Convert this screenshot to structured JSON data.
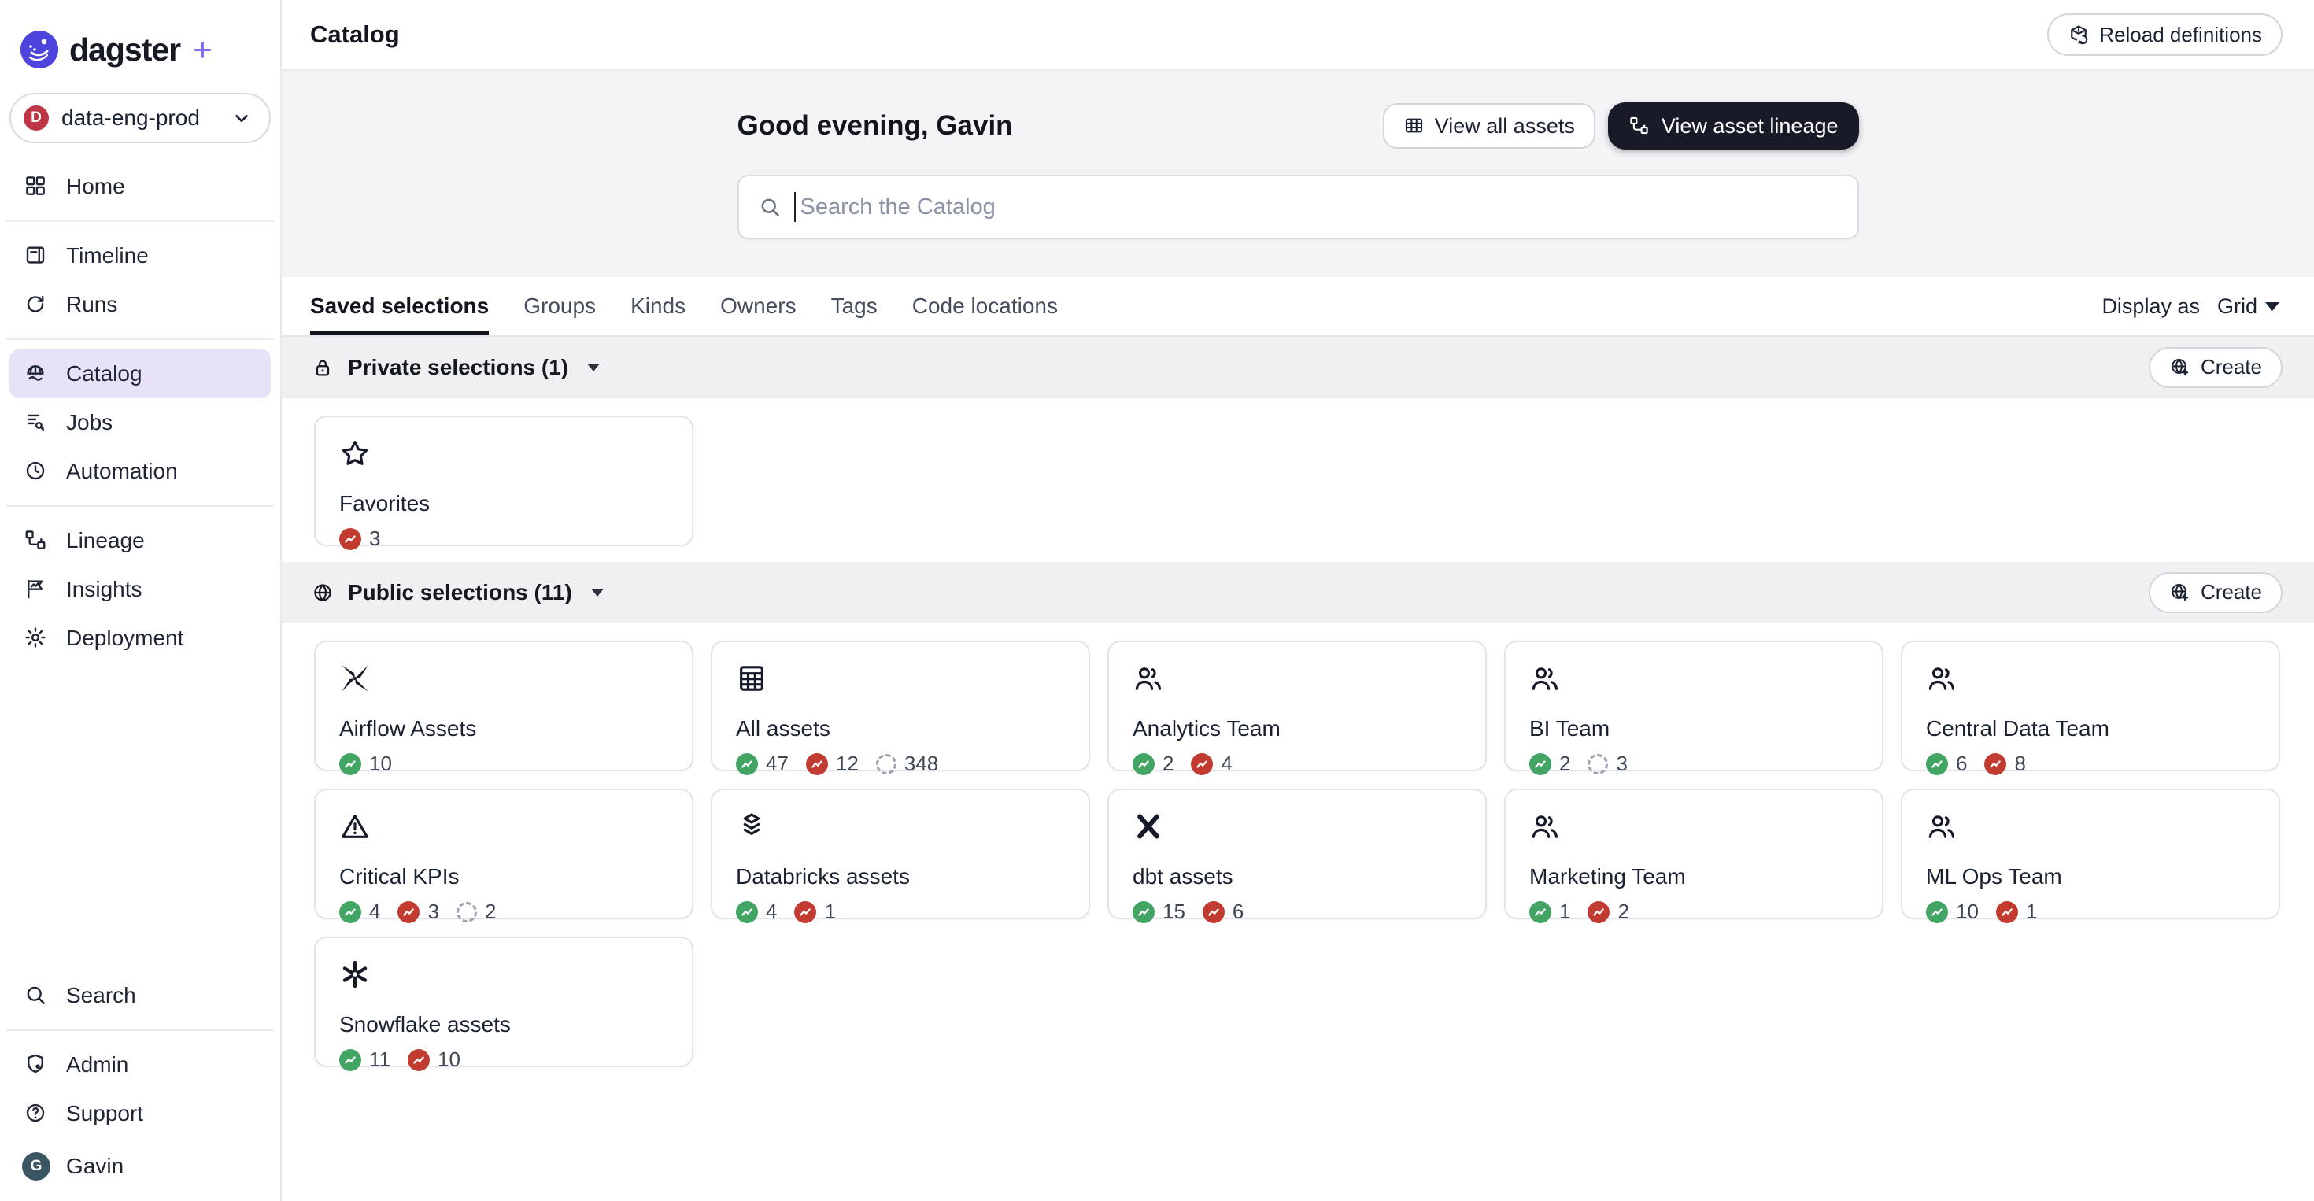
{
  "brand": {
    "name": "dagster",
    "plus": "+"
  },
  "workspace": {
    "label": "data-eng-prod",
    "avatar_letter": "D",
    "avatar_color": "#BE3645"
  },
  "sidebar": {
    "groups": [
      {
        "items": [
          {
            "label": "Home",
            "icon": "home-grid",
            "active": false
          }
        ]
      },
      {
        "items": [
          {
            "label": "Timeline",
            "icon": "timeline",
            "active": false
          },
          {
            "label": "Runs",
            "icon": "runs",
            "active": false
          }
        ]
      },
      {
        "items": [
          {
            "label": "Catalog",
            "icon": "catalog-globe",
            "active": true
          },
          {
            "label": "Jobs",
            "icon": "jobs",
            "active": false
          },
          {
            "label": "Automation",
            "icon": "clock",
            "active": false
          }
        ]
      },
      {
        "items": [
          {
            "label": "Lineage",
            "icon": "lineage",
            "active": false
          },
          {
            "label": "Insights",
            "icon": "insights-flag",
            "active": false
          },
          {
            "label": "Deployment",
            "icon": "gear",
            "active": false
          }
        ]
      }
    ],
    "bottom_groups": [
      {
        "items": [
          {
            "label": "Search",
            "icon": "search",
            "active": false
          }
        ]
      },
      {
        "items": [
          {
            "label": "Admin",
            "icon": "shield",
            "active": false
          },
          {
            "label": "Support",
            "icon": "help-circle",
            "active": false
          }
        ]
      }
    ],
    "user": {
      "name": "Gavin",
      "avatar_letter": "G",
      "avatar_color": "#3B5663"
    }
  },
  "header": {
    "title": "Catalog",
    "reload_button_label": "Reload definitions"
  },
  "hero": {
    "greeting": "Good evening, Gavin",
    "view_all_assets_label": "View all assets",
    "view_asset_lineage_label": "View asset lineage",
    "search_placeholder": "Search the Catalog"
  },
  "tabs": {
    "items": [
      "Saved selections",
      "Groups",
      "Kinds",
      "Owners",
      "Tags",
      "Code locations"
    ],
    "active": "Saved selections",
    "display_as_label": "Display as",
    "display_as_value": "Grid"
  },
  "sections": [
    {
      "title": "Private selections (1)",
      "icon": "lock",
      "create_label": "Create",
      "cards": [
        {
          "title": "Favorites",
          "icon": "star",
          "counts": [
            {
              "type": "failed",
              "value": "3"
            }
          ]
        }
      ]
    },
    {
      "title": "Public selections (11)",
      "icon": "globe",
      "create_label": "Create",
      "cards": [
        {
          "title": "Airflow Assets",
          "icon": "airflow",
          "counts": [
            {
              "type": "success",
              "value": "10"
            }
          ]
        },
        {
          "title": "All assets",
          "icon": "table",
          "counts": [
            {
              "type": "success",
              "value": "47"
            },
            {
              "type": "failed",
              "value": "12"
            },
            {
              "type": "never",
              "value": "348"
            }
          ]
        },
        {
          "title": "Analytics Team",
          "icon": "people",
          "counts": [
            {
              "type": "success",
              "value": "2"
            },
            {
              "type": "failed",
              "value": "4"
            }
          ]
        },
        {
          "title": "BI Team",
          "icon": "people",
          "counts": [
            {
              "type": "success",
              "value": "2"
            },
            {
              "type": "never",
              "value": "3"
            }
          ]
        },
        {
          "title": "Central Data Team",
          "icon": "people",
          "counts": [
            {
              "type": "success",
              "value": "6"
            },
            {
              "type": "failed",
              "value": "8"
            }
          ]
        },
        {
          "title": "Critical KPIs",
          "icon": "warning",
          "counts": [
            {
              "type": "success",
              "value": "4"
            },
            {
              "type": "failed",
              "value": "3"
            },
            {
              "type": "never",
              "value": "2"
            }
          ]
        },
        {
          "title": "Databricks assets",
          "icon": "layers",
          "counts": [
            {
              "type": "success",
              "value": "4"
            },
            {
              "type": "failed",
              "value": "1"
            }
          ]
        },
        {
          "title": "dbt assets",
          "icon": "dbt",
          "counts": [
            {
              "type": "success",
              "value": "15"
            },
            {
              "type": "failed",
              "value": "6"
            }
          ]
        },
        {
          "title": "Marketing Team",
          "icon": "people",
          "counts": [
            {
              "type": "success",
              "value": "1"
            },
            {
              "type": "failed",
              "value": "2"
            }
          ]
        },
        {
          "title": "ML Ops Team",
          "icon": "people",
          "counts": [
            {
              "type": "success",
              "value": "10"
            },
            {
              "type": "failed",
              "value": "1"
            }
          ]
        },
        {
          "title": "Snowflake assets",
          "icon": "snowflake",
          "counts": [
            {
              "type": "success",
              "value": "11"
            },
            {
              "type": "failed",
              "value": "10"
            }
          ]
        }
      ]
    }
  ],
  "colors": {
    "accent_purple": "#4F43DD",
    "plus_purple": "#7C6CF3",
    "active_nav_bg": "#E7E2F8",
    "success_green": "#43A564",
    "failed_red": "#C13B30",
    "never_gray": "#9AA1AC",
    "dark_button_bg": "#181B27",
    "hero_bg": "#F4F4F7",
    "band_bg": "#F0F0F3"
  }
}
